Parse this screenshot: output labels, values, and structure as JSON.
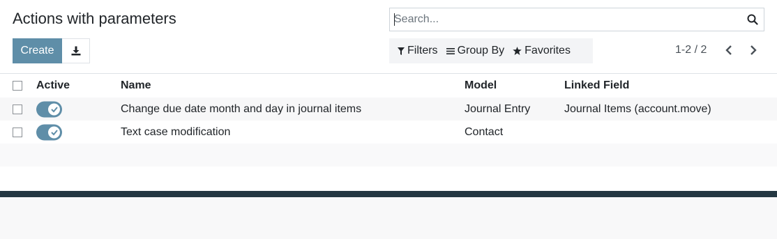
{
  "page": {
    "title": "Actions with parameters"
  },
  "search": {
    "placeholder": "Search..."
  },
  "buttons": {
    "create_label": "Create"
  },
  "filters": {
    "filters_label": "Filters",
    "groupby_label": "Group By",
    "favorites_label": "Favorites"
  },
  "pager": {
    "text": "1-2 / 2"
  },
  "table": {
    "columns": {
      "active": "Active",
      "name": "Name",
      "model": "Model",
      "linked_field": "Linked Field"
    },
    "rows": [
      {
        "active": true,
        "name": "Change due date month and day in journal items",
        "model": "Journal Entry",
        "linked_field": "Journal Items (account.move)"
      },
      {
        "active": true,
        "name": "Text case modification",
        "model": "Contact",
        "linked_field": ""
      }
    ]
  },
  "colors": {
    "primary": "#5f8ea8",
    "footer": "#243742"
  }
}
